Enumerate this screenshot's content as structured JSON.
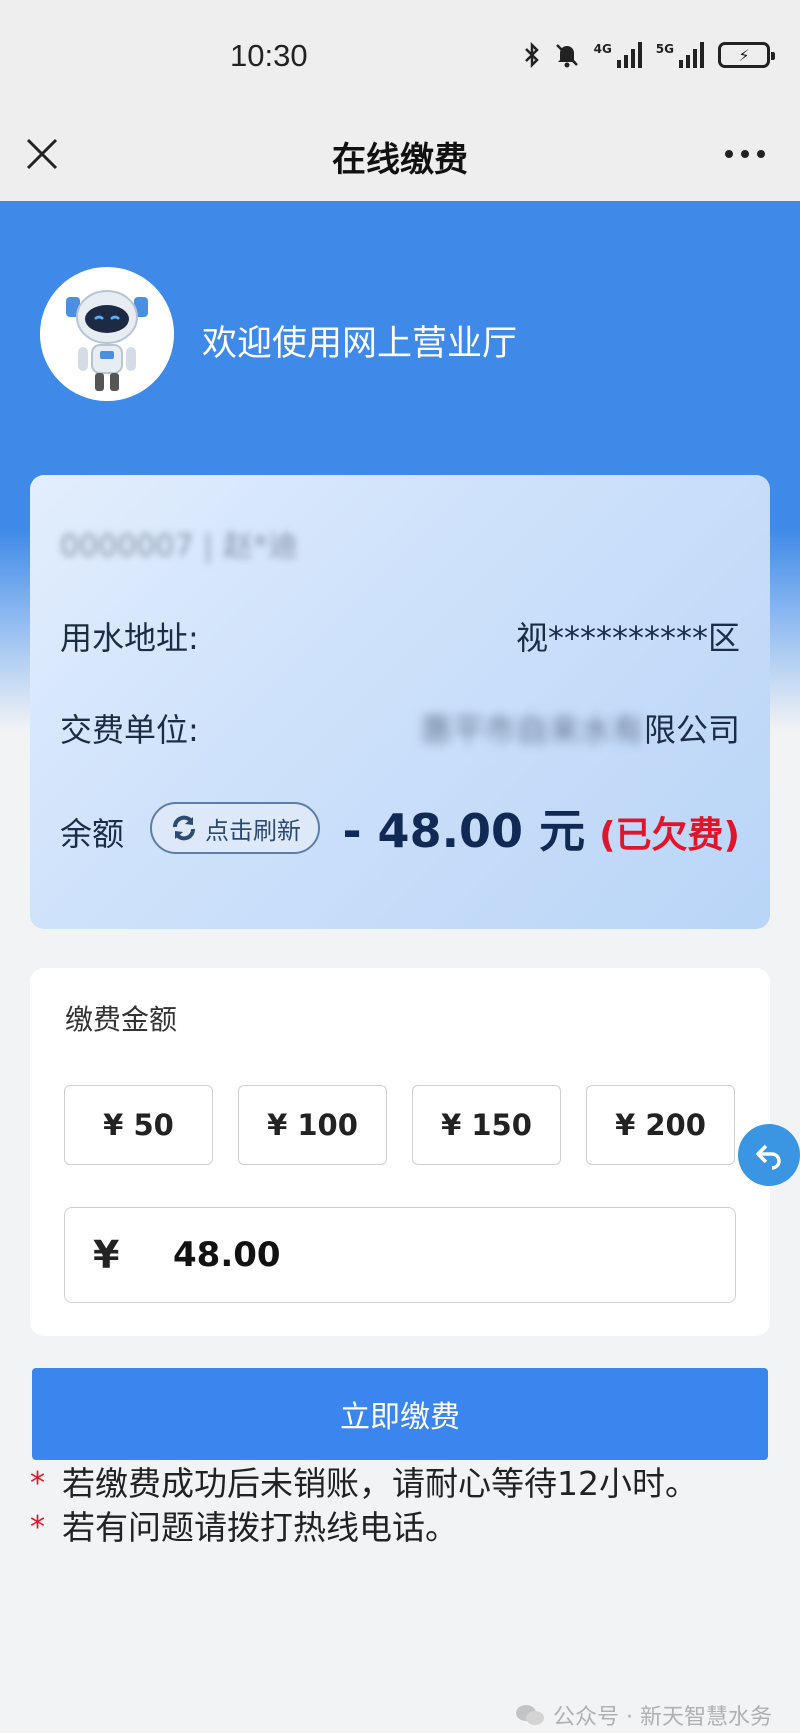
{
  "status_bar": {
    "time": "10:30",
    "sig1_tag": "4G",
    "sig2_tag": "5G"
  },
  "nav": {
    "title": "在线缴费"
  },
  "hero": {
    "welcome": "欢迎使用网上营业厅"
  },
  "account": {
    "id_name": "0000007 | 赵*迪",
    "address_label": "用水地址:",
    "address_value": "视**********区",
    "unit_label": "交费单位:",
    "unit_value_blurred": "惠平市自来水有",
    "unit_value_visible": "限公司",
    "balance_label": "余额",
    "refresh_label": "点击刷新",
    "balance_amount": "- 48.00 元",
    "balance_status": "(已欠费)"
  },
  "payment": {
    "title": "缴费金额",
    "options": [
      "¥ 50",
      "¥ 100",
      "¥ 150",
      "¥ 200"
    ],
    "currency": "¥",
    "amount": "48.00"
  },
  "submit_label": "立即缴费",
  "notes": [
    "若缴费成功后未销账，请耐心等待12小时。",
    "若有问题请拨打热线电话。"
  ],
  "note_marker": "*",
  "watermark": "公众号 · 新天智慧水务",
  "colors": {
    "primary": "#3b86ee",
    "hero": "#3f8ae8",
    "warning": "#e0142a"
  }
}
